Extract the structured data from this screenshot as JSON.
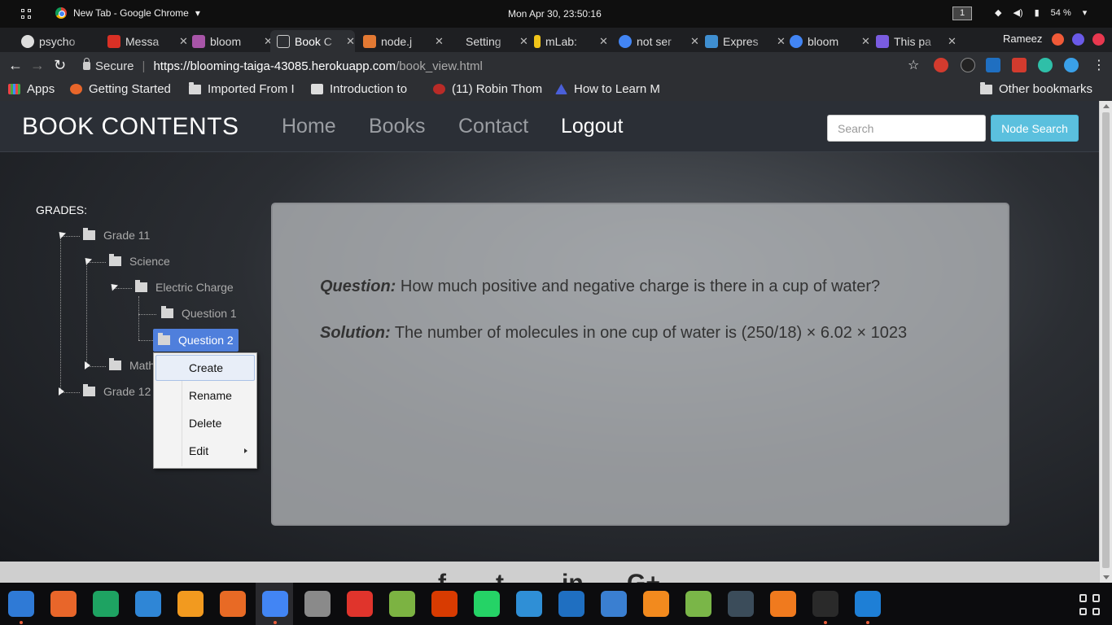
{
  "os": {
    "window_title": "New Tab - Google Chrome",
    "clock": "Mon Apr 30, 23:50:16",
    "workspace": "1",
    "battery": "54 %"
  },
  "tabs": [
    {
      "label": "psycho",
      "color": "#333333"
    },
    {
      "label": "Messa",
      "color": "#d93025"
    },
    {
      "label": "bloom",
      "color": "#a855a8"
    },
    {
      "label": "Book C",
      "color": "#dddddd",
      "active": true
    },
    {
      "label": "node.j",
      "color": "#e37933"
    },
    {
      "label": "Setting",
      "color": "#2d2f33"
    },
    {
      "label": "mLab:",
      "color": "#f0c419"
    },
    {
      "label": "not ser",
      "color": "#4285f4"
    },
    {
      "label": "Expres",
      "color": "#3f8fd1"
    },
    {
      "label": "bloom",
      "color": "#4285f4"
    },
    {
      "label": "This pa",
      "color": "#7a5ce0"
    }
  ],
  "profile": "Rameez",
  "omnibox": {
    "secure_label": "Secure",
    "host": "https://blooming-taiga-43085.herokuapp.com",
    "path": "/book_view.html"
  },
  "bookmarks": [
    {
      "label": "Apps"
    },
    {
      "label": "Getting Started"
    },
    {
      "label": "Imported From I"
    },
    {
      "label": "Introduction to"
    },
    {
      "label": "(11) Robin Thom"
    },
    {
      "label": "How to Learn M"
    },
    {
      "label": "Other bookmarks"
    }
  ],
  "site": {
    "brand": "BOOK CONTENTS",
    "nav": [
      "Home",
      "Books",
      "Contact",
      "Logout"
    ],
    "search_placeholder": "Search",
    "search_button": "Node Search"
  },
  "tree": {
    "heading": "GRADES:",
    "nodes": [
      "Grade 11",
      "Science",
      "Electric Charge",
      "Question 1",
      "Question 2",
      "Math",
      "Grade 12"
    ]
  },
  "context_menu": [
    "Create",
    "Rename",
    "Delete",
    "Edit"
  ],
  "content": {
    "question_label": "Question:",
    "question_text": " How much positive and negative charge is there in a cup of water?",
    "solution_label": "Solution:",
    "solution_text": " The number of molecules in one cup of water is (250/18) × 6.02 × 1023"
  },
  "footer_icons": [
    "facebook-icon",
    "twitter-icon",
    "linkedin-icon",
    "google-plus-icon"
  ],
  "footer_glyphs": [
    "f",
    "t",
    "in",
    "G+"
  ],
  "dock": [
    {
      "name": "files-icon",
      "color": "#2f7ad6"
    },
    {
      "name": "firefox-icon",
      "color": "#e8662a"
    },
    {
      "name": "sheets-icon",
      "color": "#1ea362"
    },
    {
      "name": "docs-icon",
      "color": "#2f86d6"
    },
    {
      "name": "slides-icon",
      "color": "#f29a1f"
    },
    {
      "name": "software-center-icon",
      "color": "#e86a25"
    },
    {
      "name": "chrome-icon",
      "color": "#4285f4"
    },
    {
      "name": "clock-icon",
      "color": "#8a8a8a"
    },
    {
      "name": "pdf-icon",
      "color": "#e0342c"
    },
    {
      "name": "android-studio-icon",
      "color": "#7cb342"
    },
    {
      "name": "office-icon",
      "color": "#d83b01"
    },
    {
      "name": "whatsapp-icon",
      "color": "#25d366"
    },
    {
      "name": "fish-icon",
      "color": "#2f8fd6"
    },
    {
      "name": "remote-icon",
      "color": "#1f6fc1"
    },
    {
      "name": "shark-icon",
      "color": "#3a7fd1"
    },
    {
      "name": "vlc-icon",
      "color": "#f28a1e"
    },
    {
      "name": "image-viewer-icon",
      "color": "#7ab648"
    },
    {
      "name": "steam-icon",
      "color": "#3b4c5a"
    },
    {
      "name": "xampp-icon",
      "color": "#f07a1e"
    },
    {
      "name": "terminal-icon",
      "color": "#2a2a2a"
    },
    {
      "name": "vscode-icon",
      "color": "#1e7fd6"
    }
  ]
}
